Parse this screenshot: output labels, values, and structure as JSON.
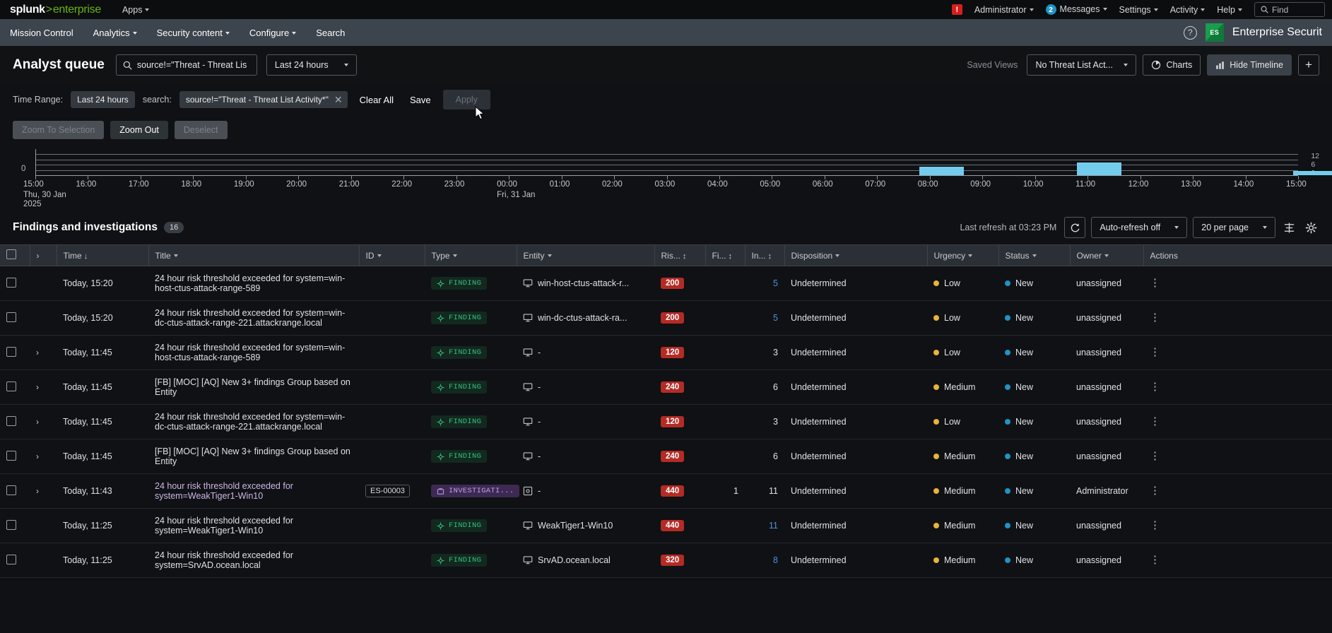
{
  "topbar": {
    "logo_main": "splunk",
    "logo_sep": ">",
    "logo_sub": "enterprise",
    "apps_label": "Apps",
    "alert_badge": "!",
    "administrator_label": "Administrator",
    "messages_count": "2",
    "messages_label": "Messages",
    "settings_label": "Settings",
    "activity_label": "Activity",
    "help_label": "Help",
    "find_placeholder": "Find"
  },
  "navbar": {
    "items": [
      {
        "label": "Mission Control",
        "has_caret": false
      },
      {
        "label": "Analytics",
        "has_caret": true
      },
      {
        "label": "Security content",
        "has_caret": true
      },
      {
        "label": "Configure",
        "has_caret": true
      },
      {
        "label": "Search",
        "has_caret": false
      }
    ],
    "help_icon": "?",
    "es_badge": "ES",
    "app_name": "Enterprise Securit"
  },
  "page_header": {
    "title": "Analyst queue",
    "search_value": "source!=\"Threat - Threat Lis",
    "time_picker": "Last 24 hours",
    "saved_views_label": "Saved Views",
    "saved_view_value": "No Threat List Act...",
    "charts_label": "Charts",
    "hide_timeline_label": "Hide Timeline",
    "add_label": "+"
  },
  "filter_bar": {
    "time_range_label": "Time Range:",
    "time_range_value": "Last 24 hours",
    "search_label": "search:",
    "search_chip_value": "source!=\"Threat - Threat List Activity*\"",
    "clear_all_label": "Clear All",
    "save_label": "Save",
    "apply_label": "Apply"
  },
  "zoom_controls": {
    "zoom_to_selection": "Zoom To Selection",
    "zoom_out": "Zoom Out",
    "deselect": "Deselect"
  },
  "chart_data": {
    "type": "bar",
    "title": "",
    "xlabel": "",
    "ylabel": "",
    "y_zero_label": "0",
    "right_axis_labels": [
      "12",
      "6",
      "0"
    ],
    "ylim": [
      0,
      12
    ],
    "grid": true,
    "legend": "none",
    "bar_color": "#73ccee",
    "x_tick_labels": [
      "15:00",
      "16:00",
      "17:00",
      "18:00",
      "19:00",
      "20:00",
      "21:00",
      "22:00",
      "23:00",
      "00:00",
      "01:00",
      "02:00",
      "03:00",
      "04:00",
      "05:00",
      "06:00",
      "07:00",
      "08:00",
      "09:00",
      "10:00",
      "11:00",
      "12:00",
      "13:00",
      "14:00",
      "15:00"
    ],
    "date_markers": [
      {
        "at_index": 0,
        "line1": "Thu, 30 Jan",
        "line2": "2025"
      },
      {
        "at_index": 9,
        "line1": "Fri, 31 Jan",
        "line2": ""
      }
    ],
    "bars": [
      {
        "x_label": "07:45",
        "x_index": 16.8,
        "value": 4
      },
      {
        "x_label": "10:45",
        "x_index": 19.8,
        "value": 6
      },
      {
        "x_label": "14:50",
        "x_index": 23.9,
        "value": 2
      }
    ]
  },
  "findings": {
    "title": "Findings and investigations",
    "count": "16",
    "last_refresh": "Last refresh at 03:23 PM",
    "refresh_icon": "refresh-icon",
    "auto_refresh": "Auto-refresh off",
    "per_page": "20 per page",
    "density_icon": "density-icon",
    "settings_icon": "gear-icon"
  },
  "table": {
    "columns": [
      {
        "key": "checkbox",
        "label": "",
        "sort": ""
      },
      {
        "key": "expand",
        "label": "",
        "sort": ""
      },
      {
        "key": "time",
        "label": "Time",
        "sort": "down"
      },
      {
        "key": "title",
        "label": "Title",
        "sort": "caret"
      },
      {
        "key": "id",
        "label": "ID",
        "sort": "caret"
      },
      {
        "key": "type",
        "label": "Type",
        "sort": "caret"
      },
      {
        "key": "entity",
        "label": "Entity",
        "sort": "caret"
      },
      {
        "key": "risk",
        "label": "Ris...",
        "sort": "updown"
      },
      {
        "key": "findings",
        "label": "Fi...",
        "sort": "updown"
      },
      {
        "key": "investigations",
        "label": "In...",
        "sort": "updown"
      },
      {
        "key": "disposition",
        "label": "Disposition",
        "sort": "caret"
      },
      {
        "key": "urgency",
        "label": "Urgency",
        "sort": "caret"
      },
      {
        "key": "status",
        "label": "Status",
        "sort": "caret"
      },
      {
        "key": "owner",
        "label": "Owner",
        "sort": "caret"
      },
      {
        "key": "actions",
        "label": "Actions",
        "sort": ""
      }
    ],
    "rows": [
      {
        "expandable": false,
        "time": "Today, 15:20",
        "title": "24 hour risk threshold exceeded for system=win-host-ctus-attack-range-589",
        "id": "",
        "type": "FINDING",
        "type_kind": "finding",
        "entity": "win-host-ctus-attack-r...",
        "entity_icon": "monitor-icon",
        "risk": "200",
        "findings": "",
        "investigations": "5",
        "investigations_link": true,
        "disposition": "Undetermined",
        "urgency": "Low",
        "status": "New",
        "owner": "unassigned"
      },
      {
        "expandable": false,
        "time": "Today, 15:20",
        "title": "24 hour risk threshold exceeded for system=win-dc-ctus-attack-range-221.attackrange.local",
        "id": "",
        "type": "FINDING",
        "type_kind": "finding",
        "entity": "win-dc-ctus-attack-ra...",
        "entity_icon": "monitor-icon",
        "risk": "200",
        "findings": "",
        "investigations": "5",
        "investigations_link": true,
        "disposition": "Undetermined",
        "urgency": "Low",
        "status": "New",
        "owner": "unassigned"
      },
      {
        "expandable": true,
        "time": "Today, 11:45",
        "title": "24 hour risk threshold exceeded for system=win-host-ctus-attack-range-589",
        "id": "",
        "type": "FINDING",
        "type_kind": "finding",
        "entity": "-",
        "entity_icon": "monitor-icon",
        "risk": "120",
        "findings": "",
        "investigations": "3",
        "investigations_link": false,
        "disposition": "Undetermined",
        "urgency": "Low",
        "status": "New",
        "owner": "unassigned"
      },
      {
        "expandable": true,
        "time": "Today, 11:45",
        "title": "[FB] [MOC] [AQ] New 3+ findings Group based on Entity",
        "id": "",
        "type": "FINDING",
        "type_kind": "finding",
        "entity": "-",
        "entity_icon": "monitor-icon",
        "risk": "240",
        "findings": "",
        "investigations": "6",
        "investigations_link": false,
        "disposition": "Undetermined",
        "urgency": "Medium",
        "status": "New",
        "owner": "unassigned"
      },
      {
        "expandable": true,
        "time": "Today, 11:45",
        "title": "24 hour risk threshold exceeded for system=win-dc-ctus-attack-range-221.attackrange.local",
        "id": "",
        "type": "FINDING",
        "type_kind": "finding",
        "entity": "-",
        "entity_icon": "monitor-icon",
        "risk": "120",
        "findings": "",
        "investigations": "3",
        "investigations_link": false,
        "disposition": "Undetermined",
        "urgency": "Low",
        "status": "New",
        "owner": "unassigned"
      },
      {
        "expandable": true,
        "time": "Today, 11:45",
        "title": "[FB] [MOC] [AQ] New 3+ findings Group based on Entity",
        "id": "",
        "type": "FINDING",
        "type_kind": "finding",
        "entity": "-",
        "entity_icon": "monitor-icon",
        "risk": "240",
        "findings": "",
        "investigations": "6",
        "investigations_link": false,
        "disposition": "Undetermined",
        "urgency": "Medium",
        "status": "New",
        "owner": "unassigned"
      },
      {
        "expandable": true,
        "time": "Today, 11:43",
        "title": "24 hour risk threshold exceeded for system=WeakTiger1-Win10",
        "id": "ES-00003",
        "type": "INVESTIGATI...",
        "type_kind": "investigation",
        "entity": "-",
        "entity_icon": "target-icon",
        "risk": "440",
        "findings": "1",
        "investigations": "11",
        "investigations_link": false,
        "disposition": "Undetermined",
        "urgency": "Medium",
        "status": "New",
        "owner": "Administrator"
      },
      {
        "expandable": false,
        "time": "Today, 11:25",
        "title": "24 hour risk threshold exceeded for system=WeakTiger1-Win10",
        "id": "",
        "type": "FINDING",
        "type_kind": "finding",
        "entity": "WeakTiger1-Win10",
        "entity_icon": "monitor-icon",
        "risk": "440",
        "findings": "",
        "investigations": "11",
        "investigations_link": true,
        "disposition": "Undetermined",
        "urgency": "Medium",
        "status": "New",
        "owner": "unassigned"
      },
      {
        "expandable": false,
        "time": "Today, 11:25",
        "title": "24 hour risk threshold exceeded for system=SrvAD.ocean.local",
        "id": "",
        "type": "FINDING",
        "type_kind": "finding",
        "entity": "SrvAD.ocean.local",
        "entity_icon": "monitor-icon",
        "risk": "320",
        "findings": "",
        "investigations": "8",
        "investigations_link": true,
        "disposition": "Undetermined",
        "urgency": "Medium",
        "status": "New",
        "owner": "unassigned"
      }
    ]
  },
  "colors": {
    "accent_green": "#66b512",
    "bar_cyan": "#73ccee",
    "risk_red": "#b42b25",
    "finding_green": "#31c07f",
    "investigation_purple": "#c49bf0",
    "link_blue": "#4f8fe0",
    "urgency_yellow": "#e8b33b",
    "status_blue": "#1e93c6"
  }
}
